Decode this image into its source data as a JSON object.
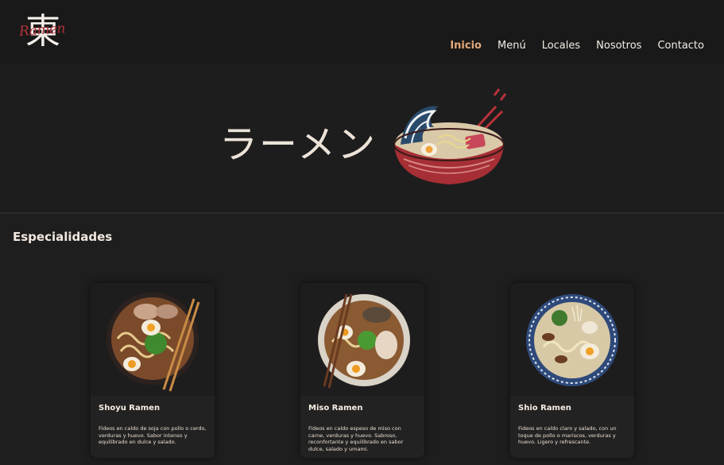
{
  "brand": {
    "logo_kanji": "東",
    "logo_script": "Ramen"
  },
  "nav": {
    "items": [
      {
        "label": "Inicio",
        "active": true
      },
      {
        "label": "Menú",
        "active": false
      },
      {
        "label": "Locales",
        "active": false
      },
      {
        "label": "Nosotros",
        "active": false
      },
      {
        "label": "Contacto",
        "active": false
      }
    ]
  },
  "hero": {
    "title": "ラーメン",
    "image_icon": "ramen-bowl-wave-icon"
  },
  "specials": {
    "heading": "Especialidades",
    "cards": [
      {
        "name": "Shoyu Ramen",
        "description": "Fideos en caldo de soja con pollo o cerdo, verduras y huevo. Sabor intenso y equilibrado en dulce y salado."
      },
      {
        "name": "Miso Ramen",
        "description": "Fideos en caldo espeso de miso con carne, verduras y huevo. Sabroso, reconfortante y equilibrado en sabor dulce, salado y umami."
      },
      {
        "name": "Shio Ramen",
        "description": "Fideos en caldo claro y salado, con un toque de pollo o mariscos, verduras y huevo. Ligero y refrescante."
      }
    ]
  },
  "colors": {
    "accent": "#e3a97a",
    "background": "#1f1e1e",
    "logo_red": "#b1323a"
  }
}
